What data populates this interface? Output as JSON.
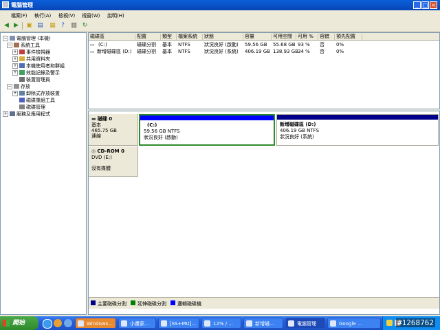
{
  "window": {
    "title": "電腦管理",
    "minimize": "_",
    "maximize": "□",
    "close": "×"
  },
  "menu": [
    "檔案(F)",
    "執行(A)",
    "檢視(V)",
    "視窗(W)",
    "說明(H)"
  ],
  "tree": {
    "root": "電腦管理 (本機)",
    "system_tools": "系統工具",
    "event_viewer": "事件檢視器",
    "shared_folders": "共用資料夾",
    "local_users": "本機使用者和群組",
    "perf_logs": "效能記錄及警示",
    "device_manager": "裝置管理員",
    "storage": "存放",
    "removable": "卸除式存放裝置",
    "defrag": "磁碟重組工具",
    "disk_mgmt": "磁碟管理",
    "services": "服務及應用程式"
  },
  "volume_table": {
    "headers": [
      "磁碟區",
      "配置",
      "類型",
      "檔案系統",
      "狀態",
      "容量",
      "可用空間",
      "可用 %",
      "容錯",
      "預先配置"
    ],
    "rows": [
      [
        "(C:)",
        "磁碟分割",
        "基本",
        "NTFS",
        "狀況良好 (啟動)",
        "59.56 GB",
        "55.68 GB",
        "93 %",
        "否",
        "0%"
      ],
      [
        "新增磁碟區 (D:)",
        "磁碟分割",
        "基本",
        "NTFS",
        "狀況良好 (系統)",
        "406.19 GB",
        "138.93 GB",
        "34 %",
        "否",
        "0%"
      ]
    ]
  },
  "disk0": {
    "name": "磁碟 0",
    "type": "基本",
    "size": "465.75 GB",
    "status": "連線"
  },
  "part_c": {
    "name": "(C:)",
    "size": "59.56 GB NTFS",
    "status": "狀況良好 (啟動)"
  },
  "part_d": {
    "name": "新增磁碟區 (D:)",
    "size": "406.19 GB NTFS",
    "status": "狀況良好 (系統)"
  },
  "cdrom": {
    "name": "CD-ROM 0",
    "drive": "DVD (E:)",
    "media": "沒有媒體"
  },
  "legend": [
    {
      "label": "主要磁碟分割",
      "color": "#00008b"
    },
    {
      "label": "延伸磁碟分割",
      "color": "#008000"
    },
    {
      "label": "邏輯磁碟機",
      "color": "#0000ff"
    }
  ],
  "taskbar": {
    "start": "開始",
    "tasks": [
      "Windows...",
      "小畫家...",
      "[SS+MU]...",
      "12% / ...",
      "新增磁...",
      "電腦管理",
      "Google ..."
    ],
    "badge": "#1268762"
  },
  "colors": {
    "titlebar": "#0a5fd8",
    "partition_bar": "#0000ff",
    "selected_border": "#2e8a2a",
    "disk_bar": "#00008b"
  }
}
